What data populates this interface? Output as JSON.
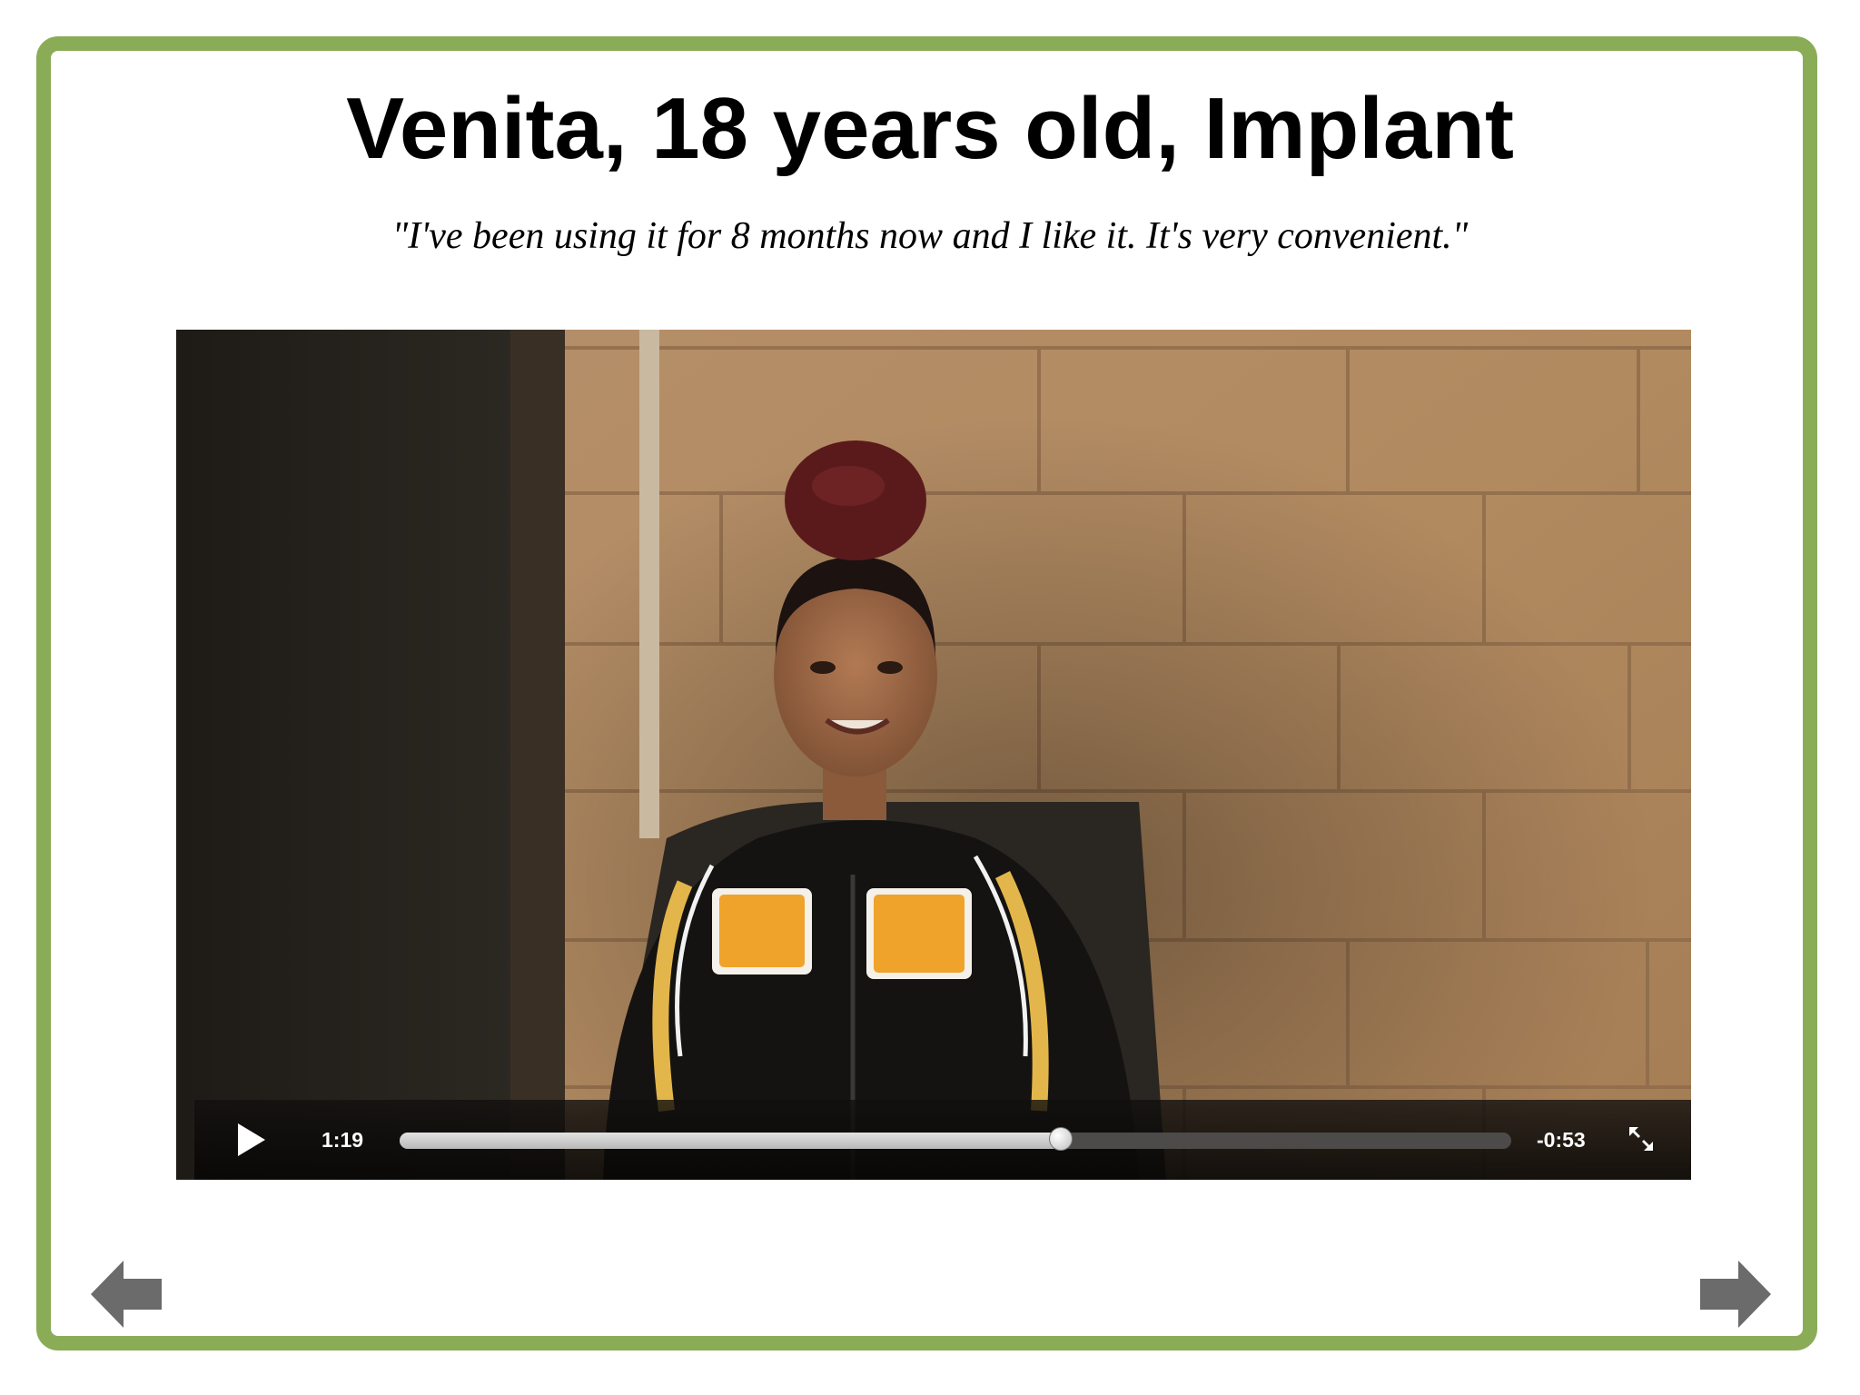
{
  "page": {
    "title": "Venita, 18 years old, Implant",
    "quote": "\"I've been using it for 8 months now and I like it. It's very convenient.\""
  },
  "video": {
    "current_time": "1:19",
    "remaining_time": "-0:53",
    "progress": 0.595
  },
  "icons": {
    "play": "play-icon",
    "fullscreen": "fullscreen-icon",
    "prev": "arrow-left-icon",
    "next": "arrow-right-icon"
  },
  "colors": {
    "frame_border": "#8aac57",
    "arrow": "#6b6b6b"
  }
}
